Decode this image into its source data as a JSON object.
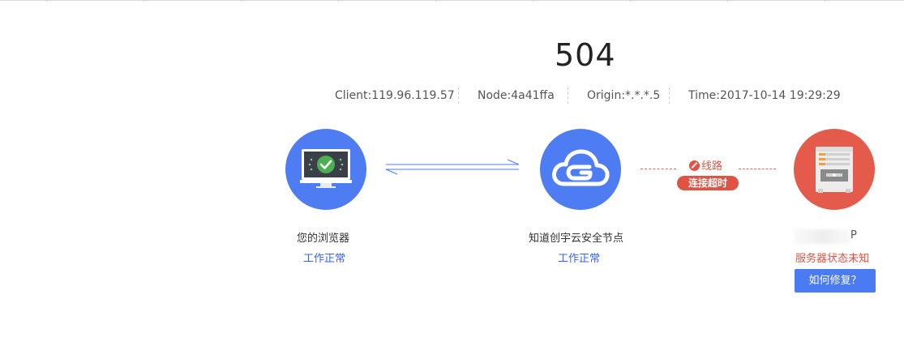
{
  "error": {
    "code": "504"
  },
  "meta": {
    "client": "Client:119.96.119.57",
    "node": "Node:4a41ffa",
    "origin": "Origin:*.*.*.5",
    "time": "Time:2017-10-14 19:29:29"
  },
  "browser": {
    "label": "您的浏览器",
    "status": "工作正常"
  },
  "node": {
    "label": "知道创宇云安全节点",
    "status": "工作正常"
  },
  "link": {
    "route": "线路",
    "error": "连接超时"
  },
  "server": {
    "label_tail": "P",
    "status": "服务器状态未知",
    "fix_button": "如何修复？"
  },
  "colors": {
    "ok_blue": "#4d7cf3",
    "error_red": "#e45a4b",
    "ok_text": "#3a64e0",
    "error_text": "#e05343"
  }
}
